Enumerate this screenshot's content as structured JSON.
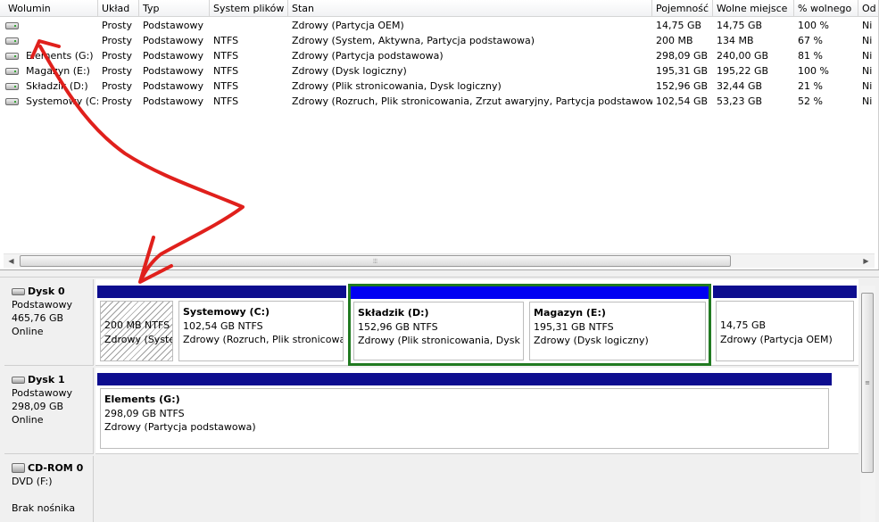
{
  "volume_list": {
    "columns": [
      "Wolumin",
      "Układ",
      "Typ",
      "System plików",
      "Stan",
      "Pojemność",
      "Wolne miejsce",
      "% wolnego",
      "Od"
    ],
    "rows": [
      [
        "",
        "Prosty",
        "Podstawowy",
        "",
        "Zdrowy (Partycja OEM)",
        "14,75 GB",
        "14,75 GB",
        "100 %",
        "Ni"
      ],
      [
        "",
        "Prosty",
        "Podstawowy",
        "NTFS",
        "Zdrowy (System, Aktywna, Partycja podstawowa)",
        "200 MB",
        "134 MB",
        "67 %",
        "Ni"
      ],
      [
        "Elements (G:)",
        "Prosty",
        "Podstawowy",
        "NTFS",
        "Zdrowy (Partycja podstawowa)",
        "298,09 GB",
        "240,00 GB",
        "81 %",
        "Ni"
      ],
      [
        "Magazyn (E:)",
        "Prosty",
        "Podstawowy",
        "NTFS",
        "Zdrowy (Dysk logiczny)",
        "195,31 GB",
        "195,22 GB",
        "100 %",
        "Ni"
      ],
      [
        "Składzik (D:)",
        "Prosty",
        "Podstawowy",
        "NTFS",
        "Zdrowy (Plik stronicowania, Dysk logiczny)",
        "152,96 GB",
        "32,44 GB",
        "21 %",
        "Ni"
      ],
      [
        "Systemowy (C:)",
        "Prosty",
        "Podstawowy",
        "NTFS",
        "Zdrowy (Rozruch, Plik stronicowania, Zrzut awaryjny, Partycja podstawowa)",
        "102,54 GB",
        "53,23 GB",
        "52 %",
        "Ni"
      ]
    ],
    "volume_icon": "hard-disk-icon",
    "scroll_grip": "⦙⦙⦙"
  },
  "disks": [
    {
      "name": "Dysk 0",
      "type": "Podstawowy",
      "size": "465,76 GB",
      "status": "Online",
      "icon": "hard-disk-icon",
      "partitions": [
        {
          "title": "",
          "size": "200 MB NTFS",
          "status": "Zdrowy (System, Aktywna, Partycja podstawowa)",
          "kind": "primary",
          "hatched": true
        },
        {
          "title": "Systemowy (C:)",
          "size": "102,54 GB NTFS",
          "status": "Zdrowy (Rozruch, Plik stronicowania, Zrzut awaryjny, Partycja podstawowa)",
          "kind": "primary"
        },
        {
          "title": "Składzik (D:)",
          "size": "152,96 GB NTFS",
          "status": "Zdrowy (Plik stronicowania, Dysk logiczny)",
          "kind": "logical"
        },
        {
          "title": "Magazyn (E:)",
          "size": "195,31 GB NTFS",
          "status": "Zdrowy (Dysk logiczny)",
          "kind": "logical"
        },
        {
          "title": "",
          "size": "14,75 GB",
          "status": "Zdrowy (Partycja OEM)",
          "kind": "primary"
        }
      ]
    },
    {
      "name": "Dysk 1",
      "type": "Podstawowy",
      "size": "298,09 GB",
      "status": "Online",
      "icon": "hard-disk-icon",
      "partitions": [
        {
          "title": "Elements (G:)",
          "size": "298,09 GB NTFS",
          "status": "Zdrowy (Partycja podstawowa)",
          "kind": "primary"
        }
      ]
    },
    {
      "name": "CD-ROM 0",
      "type": "DVD (F:)",
      "status": "Brak nośnika",
      "icon": "cd-rom-icon"
    }
  ],
  "colors": {
    "primary_partition": "#0d0d8f",
    "logical_drive": "#0000f2",
    "extended_partition_frame": "#217a21",
    "annotation_arrow": "#e0201c"
  },
  "annotation": {
    "kind": "hand-drawn double-headed arrow",
    "icon": "red-arrow-annotation"
  }
}
